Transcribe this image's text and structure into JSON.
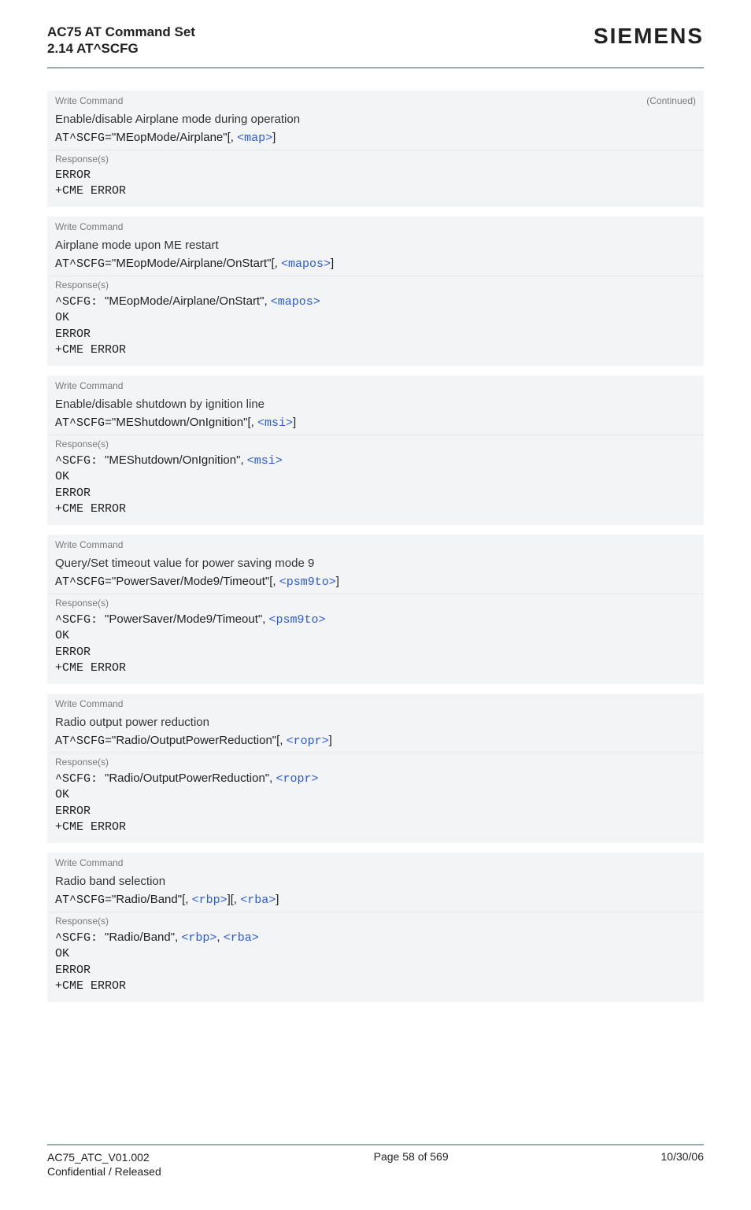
{
  "header": {
    "line1": "AC75 AT Command Set",
    "line2": "2.14 AT^SCFG",
    "brand": "SIEMENS"
  },
  "labels": {
    "write_command": "Write Command",
    "continued": "(Continued)",
    "responses": "Response(s)"
  },
  "tokens": {
    "at_scfg": "AT^SCFG=",
    "caret_scfg": "^SCFG: ",
    "lbrack_comma": "[, ",
    "rbrack": "]",
    "comma": ", ",
    "ok": "OK",
    "error": "ERROR",
    "cme_error": "+CME ERROR"
  },
  "blocks": [
    {
      "continued": true,
      "desc": "Enable/disable Airplane mode during operation",
      "cmd_string": "\"MEopMode/Airplane\"",
      "params": [
        "<map>"
      ],
      "response_echo": null
    },
    {
      "continued": false,
      "desc": "Airplane mode upon ME restart",
      "cmd_string": "\"MEopMode/Airplane/OnStart\"",
      "params": [
        "<mapos>"
      ],
      "response_echo": {
        "string": "\"MEopMode/Airplane/OnStart\"",
        "params": [
          "<mapos>"
        ]
      }
    },
    {
      "continued": false,
      "desc": "Enable/disable shutdown by ignition line",
      "cmd_string": "\"MEShutdown/OnIgnition\"",
      "params": [
        "<msi>"
      ],
      "response_echo": {
        "string": "\"MEShutdown/OnIgnition\"",
        "params": [
          "<msi>"
        ]
      }
    },
    {
      "continued": false,
      "desc": "Query/Set timeout value for power saving mode 9",
      "cmd_string": "\"PowerSaver/Mode9/Timeout\"",
      "params": [
        "<psm9to>"
      ],
      "response_echo": {
        "string": "\"PowerSaver/Mode9/Timeout\"",
        "params": [
          "<psm9to>"
        ]
      }
    },
    {
      "continued": false,
      "desc": "Radio output power reduction",
      "cmd_string": "\"Radio/OutputPowerReduction\"",
      "params": [
        "<ropr>"
      ],
      "response_echo": {
        "string": "\"Radio/OutputPowerReduction\"",
        "params": [
          "<ropr>"
        ]
      }
    },
    {
      "continued": false,
      "desc": "Radio band selection",
      "cmd_string": "\"Radio/Band\"",
      "params": [
        "<rbp>",
        "<rba>"
      ],
      "response_echo": {
        "string": "\"Radio/Band\"",
        "params": [
          "<rbp>",
          "<rba>"
        ]
      }
    }
  ],
  "footer": {
    "left1": "AC75_ATC_V01.002",
    "left2": "Confidential / Released",
    "center": "Page 58 of 569",
    "right": "10/30/06"
  }
}
